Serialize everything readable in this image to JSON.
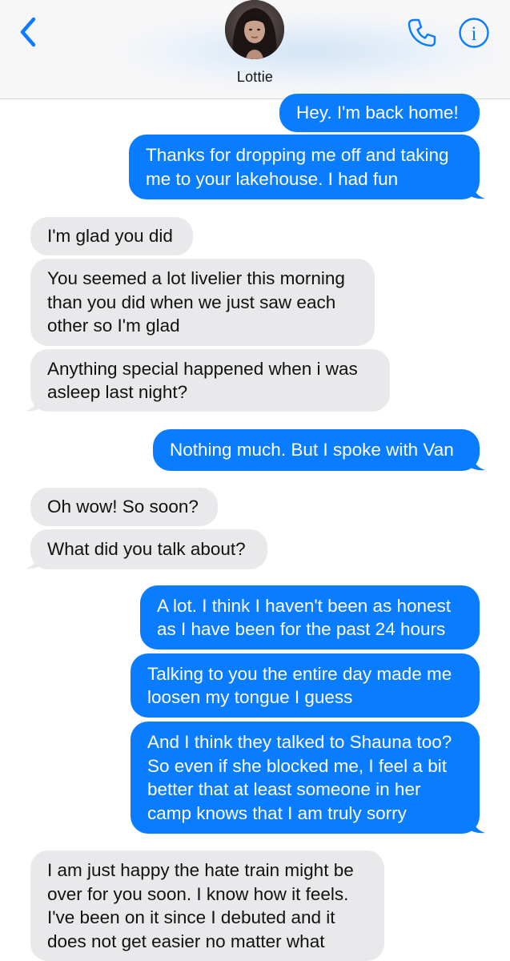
{
  "header": {
    "contact_name": "Lottie",
    "back_icon": "chevron-left-icon",
    "call_icon": "phone-icon",
    "info_icon": "info-icon",
    "info_glyph": "i",
    "accent_color": "#0a7cff"
  },
  "colors": {
    "outgoing_bubble": "#0a7cff",
    "incoming_bubble": "#e9e9eb"
  },
  "messages": [
    {
      "direction": "outgoing",
      "text": "Hey. I'm back home!"
    },
    {
      "direction": "outgoing",
      "text": "Thanks for dropping me off and taking\nme to your lakehouse. I had fun"
    },
    {
      "direction": "incoming",
      "text": "I'm glad you did"
    },
    {
      "direction": "incoming",
      "text": "You seemed a lot livelier this morning\nthan you did when we just saw each\nother so I'm glad"
    },
    {
      "direction": "incoming",
      "text": "Anything special happened when i was\nasleep last night?"
    },
    {
      "direction": "outgoing",
      "text": "Nothing much. But I spoke with Van"
    },
    {
      "direction": "incoming",
      "text": "Oh wow! So soon?"
    },
    {
      "direction": "incoming",
      "text": "What did you talk about?"
    },
    {
      "direction": "outgoing",
      "text": "A lot. I think I haven't been as honest\nas I have been for the past 24 hours"
    },
    {
      "direction": "outgoing",
      "text": "Talking to you the entire day made me\nloosen my tongue I guess"
    },
    {
      "direction": "outgoing",
      "text": "And I think they talked to Shauna too?\nSo even if she blocked me, I feel a bit\nbetter that at least someone in her\ncamp knows that I am truly sorry"
    },
    {
      "direction": "incoming",
      "text": "I am just happy the hate train might be\nover for you soon. I know how it feels.\nI've been on it since I debuted and it\ndoes not get easier no matter what"
    }
  ]
}
